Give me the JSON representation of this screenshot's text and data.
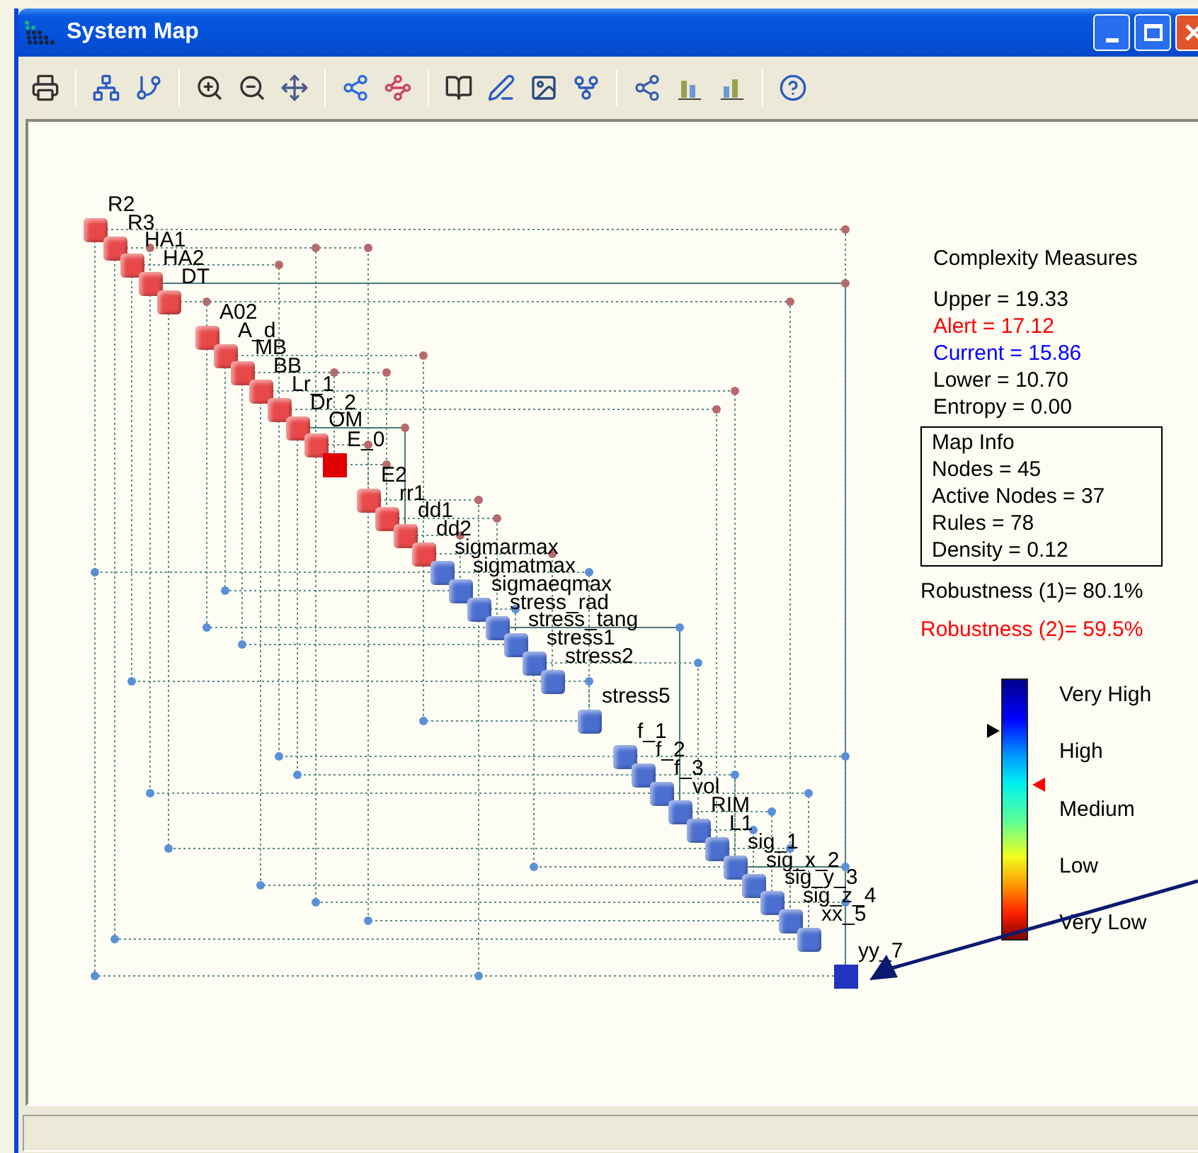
{
  "window": {
    "title": "System Map"
  },
  "nodes": [
    {
      "label": "R2",
      "color": "#e84848",
      "highlighted": false
    },
    {
      "label": "R3",
      "color": "#e84848",
      "highlighted": false
    },
    {
      "label": "HA1",
      "color": "#e84848",
      "highlighted": false
    },
    {
      "label": "HA2",
      "color": "#e84848",
      "highlighted": false
    },
    {
      "label": "DT",
      "color": "#e84848",
      "highlighted": false
    },
    {
      "label": "A02",
      "color": "#e84848",
      "highlighted": false
    },
    {
      "label": "A_d",
      "color": "#e84848",
      "highlighted": false
    },
    {
      "label": "MB",
      "color": "#e84848",
      "highlighted": false
    },
    {
      "label": "BB",
      "color": "#e84848",
      "highlighted": false
    },
    {
      "label": "Lr_1",
      "color": "#e84848",
      "highlighted": false
    },
    {
      "label": "Dr_2",
      "color": "#e84848",
      "highlighted": false
    },
    {
      "label": "OM",
      "color": "#e84848",
      "highlighted": false
    },
    {
      "label": "E_0",
      "color": "#e00000",
      "highlighted": true
    },
    {
      "label": "E2",
      "color": "#e84848",
      "highlighted": false
    },
    {
      "label": "rr1",
      "color": "#e84848",
      "highlighted": false
    },
    {
      "label": "dd1",
      "color": "#e84848",
      "highlighted": false
    },
    {
      "label": "dd2",
      "color": "#e84848",
      "highlighted": false
    },
    {
      "label": "sigmarmax",
      "color": "#4a6fd0",
      "highlighted": false
    },
    {
      "label": "sigmatmax",
      "color": "#4a6fd0",
      "highlighted": false
    },
    {
      "label": "sigmaeqmax",
      "color": "#4a6fd0",
      "highlighted": false
    },
    {
      "label": "stress_rad",
      "color": "#4a6fd0",
      "highlighted": false
    },
    {
      "label": "stress_tang",
      "color": "#4a6fd0",
      "highlighted": false
    },
    {
      "label": "stress1",
      "color": "#4a6fd0",
      "highlighted": false
    },
    {
      "label": "stress2",
      "color": "#4a6fd0",
      "highlighted": false
    },
    {
      "label": "stress5",
      "color": "#4a6fd0",
      "highlighted": false
    },
    {
      "label": "f_1",
      "color": "#4a6fd0",
      "highlighted": false
    },
    {
      "label": "f_2",
      "color": "#4a6fd0",
      "highlighted": false
    },
    {
      "label": "f_3",
      "color": "#4a6fd0",
      "highlighted": false
    },
    {
      "label": "vol",
      "color": "#4a6fd0",
      "highlighted": false
    },
    {
      "label": "RIM",
      "color": "#4a6fd0",
      "highlighted": false
    },
    {
      "label": "L1",
      "color": "#4a6fd0",
      "highlighted": false
    },
    {
      "label": "sig_1",
      "color": "#4a6fd0",
      "highlighted": false
    },
    {
      "label": "sig_x_2",
      "color": "#4a6fd0",
      "highlighted": false
    },
    {
      "label": "sig_y_3",
      "color": "#4a6fd0",
      "highlighted": false
    },
    {
      "label": "sig_z_4",
      "color": "#4a6fd0",
      "highlighted": false
    },
    {
      "label": "xx_5",
      "color": "#4a6fd0",
      "highlighted": false
    },
    {
      "label": "yy_7",
      "color": "#2233c0",
      "highlighted": true
    }
  ],
  "complexity": {
    "title": "Complexity Measures",
    "lines": [
      {
        "text": "Upper = 19.33",
        "color": "#000000"
      },
      {
        "text": "Alert = 17.12",
        "color": "#ff0000"
      },
      {
        "text": "Current = 15.86",
        "color": "#0000ff"
      },
      {
        "text": "Lower = 10.70",
        "color": "#000000"
      },
      {
        "text": "Entropy = 0.00",
        "color": "#000000"
      }
    ]
  },
  "map_info": {
    "title": "Map Info",
    "lines": [
      "Nodes = 45",
      "Active Nodes = 37",
      "Rules = 78",
      "Density = 0.12"
    ]
  },
  "robustness": [
    {
      "text": "Robustness (1)= 80.1%",
      "color": "#000000",
      "level": 0.801
    },
    {
      "text": "Robustness (2)= 59.5%",
      "color": "#ff0000",
      "level": 0.595
    }
  ],
  "scale": {
    "labels": [
      "Very High",
      "High",
      "Medium",
      "Low",
      "Very Low"
    ]
  }
}
